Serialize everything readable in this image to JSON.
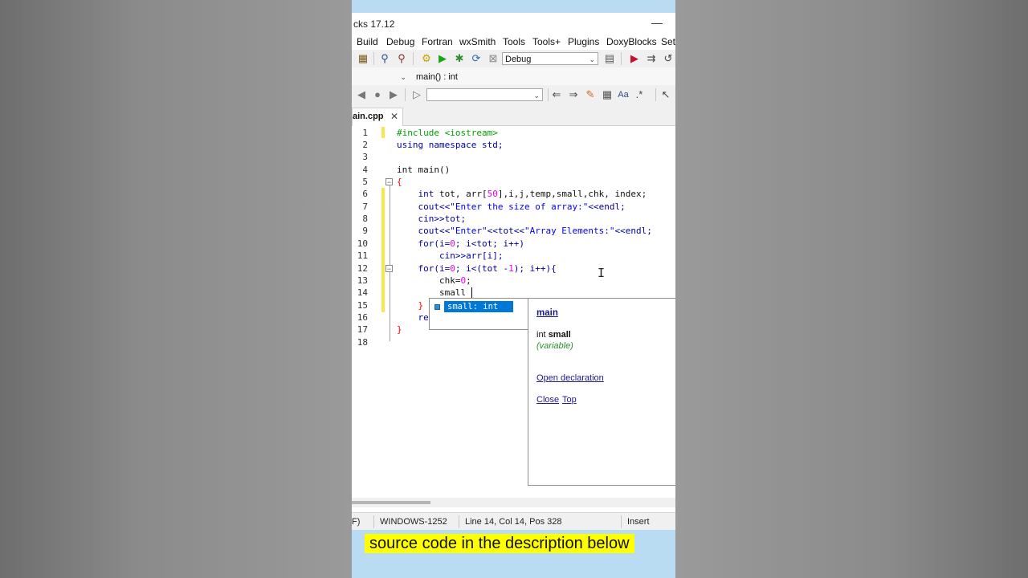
{
  "window": {
    "title": "cks 17.12",
    "minimize_label": "—"
  },
  "menubar": {
    "items": [
      "Build",
      "Debug",
      "Fortran",
      "wxSmith",
      "Tools",
      "Tools+",
      "Plugins",
      "DoxyBlocks",
      "Setti"
    ]
  },
  "toolbar": {
    "build_target": "Debug",
    "scope": "",
    "function": "main() : int",
    "search": ""
  },
  "tabs": [
    {
      "label": "ain.cpp",
      "close": "✕",
      "active": true
    }
  ],
  "editor": {
    "line_numbers": [
      "1",
      "2",
      "3",
      "4",
      "5",
      "6",
      "7",
      "8",
      "9",
      "10",
      "11",
      "12",
      "13",
      "14",
      "15",
      "16",
      "17",
      "18"
    ],
    "code": {
      "l1": "#include <iostream>",
      "l2": "using namespace std;",
      "l4": "int main()",
      "l5": "{",
      "l6a": "    int",
      "l6b": " tot, arr[",
      "l6c": "50",
      "l6d": "],i,j,temp,small,chk, index;",
      "l7a": "    cout<<",
      "l7b": "\"Enter the size of array:\"",
      "l7c": "<<endl;",
      "l8": "    cin>>tot;",
      "l9a": "    cout<<",
      "l9b": "\"Enter\"",
      "l9c": "<<tot<<",
      "l9d": "\"Array Elements:\"",
      "l9e": "<<endl;",
      "l10a": "    for(i=",
      "l10b": "0",
      "l10c": "; i<tot; i++)",
      "l11": "        cin>>arr[i];",
      "l12a": "    for(i=",
      "l12b": "0",
      "l12c": "; i<(tot -",
      "l12d": "1",
      "l12e": "); i++){",
      "l13a": "        chk=",
      "l13b": "0",
      "l13c": ";",
      "l14": "        small",
      "l15": "    }",
      "l16": "    re",
      "l17": "}"
    }
  },
  "autocomplete": {
    "selected_item": "small: int",
    "doc": {
      "scope_link": "main",
      "signature_type": "int ",
      "signature_name": "small",
      "kind": "(variable)",
      "open_declaration": "Open declaration",
      "close": "Close",
      "top": "Top"
    }
  },
  "statusbar": {
    "lineend": "F)",
    "encoding": "WINDOWS-1252",
    "position": "Line 14, Col 14, Pos 328",
    "mode": "Insert"
  },
  "caption": "source code in the description below",
  "colors": {
    "accent": "#0078d7",
    "caption_bg": "#ffff00",
    "frame_blue": "#b9dcf2"
  }
}
